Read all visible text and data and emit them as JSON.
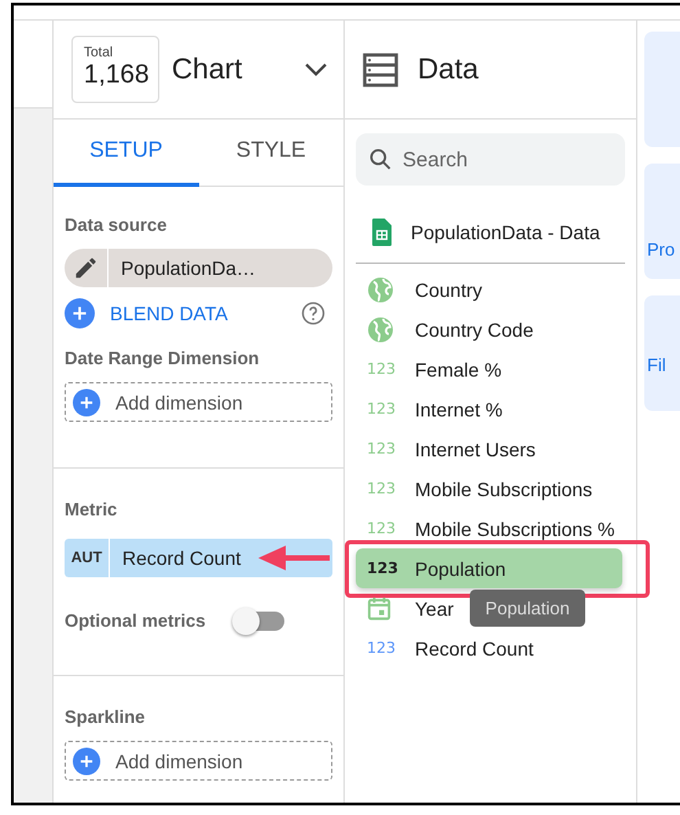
{
  "chart_header": {
    "total_label": "Total",
    "total_value": "1,168",
    "title": "Chart"
  },
  "tabs": [
    {
      "label": "SETUP",
      "selected": true
    },
    {
      "label": "STYLE",
      "selected": false
    }
  ],
  "setup": {
    "data_source": {
      "label": "Data source",
      "name": "PopulationDa…",
      "blend": "BLEND DATA"
    },
    "date_range": {
      "label": "Date Range Dimension",
      "add": "Add dimension"
    },
    "metric": {
      "label": "Metric",
      "chips": [
        {
          "type": "AUT",
          "name": "Record Count"
        }
      ],
      "optional": {
        "label": "Optional metrics",
        "on": false
      }
    },
    "sparkline": {
      "label": "Sparkline",
      "add": "Add dimension"
    }
  },
  "data_panel": {
    "title": "Data",
    "search": {
      "placeholder": "Search"
    },
    "source": "PopulationData - Data",
    "fields": [
      {
        "kind": "geo",
        "name": "Country",
        "dragging": false
      },
      {
        "kind": "geo",
        "name": "Country Code",
        "dragging": false
      },
      {
        "kind": "number",
        "type_label": "123",
        "name": "Female %",
        "dragging": false
      },
      {
        "kind": "number",
        "type_label": "123",
        "name": "Internet %",
        "dragging": false
      },
      {
        "kind": "number",
        "type_label": "123",
        "name": "Internet Users",
        "dragging": false
      },
      {
        "kind": "number",
        "type_label": "123",
        "name": "Mobile Subscriptions",
        "dragging": false
      },
      {
        "kind": "number",
        "type_label": "123",
        "name": "Mobile Subscriptions %",
        "dragging": false
      },
      {
        "kind": "number",
        "type_label": "123",
        "name": "Population",
        "dragging": true
      },
      {
        "kind": "date",
        "name": "Year",
        "dragging": false
      },
      {
        "kind": "count",
        "type_label": "123",
        "name": "Record Count",
        "dragging": false
      }
    ],
    "tooltip": "Population"
  },
  "side_cards": [
    "Pro",
    "Fil"
  ]
}
